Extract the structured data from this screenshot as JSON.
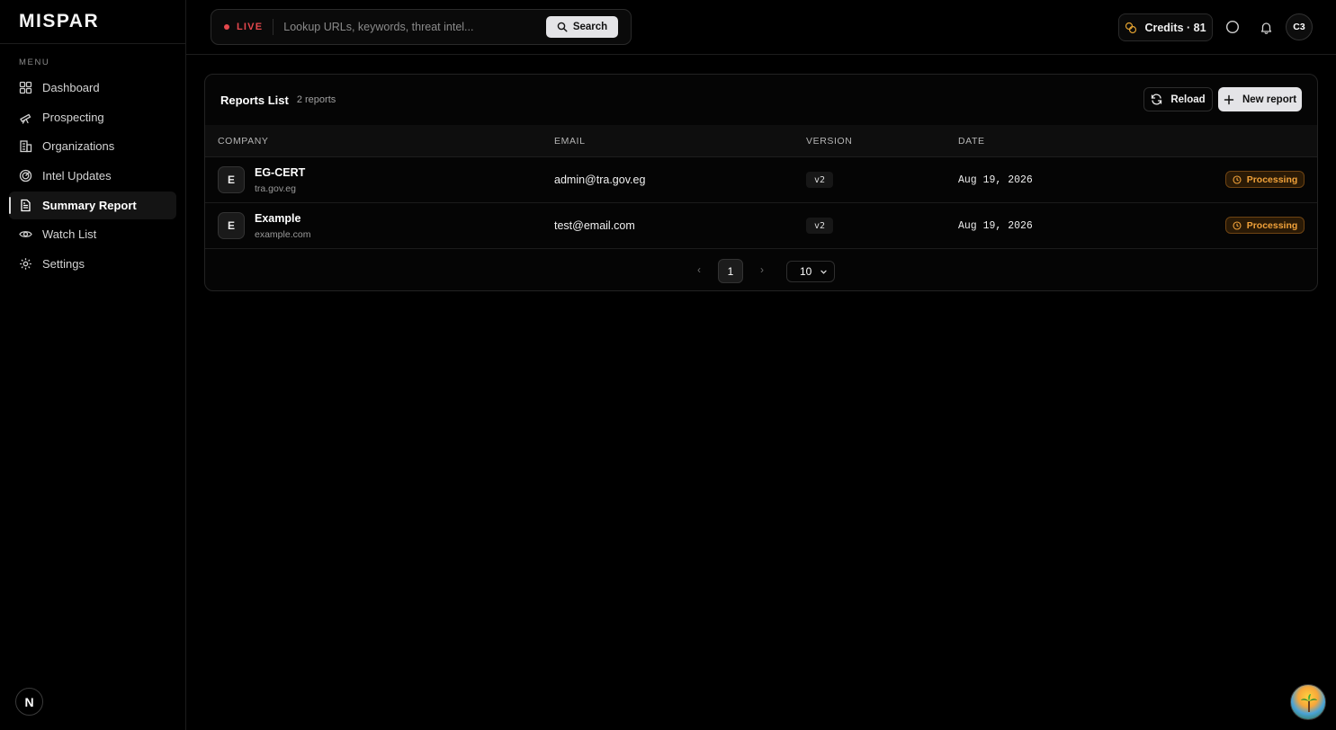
{
  "app": {
    "logo": "MISPAR",
    "menu_label": "MENU",
    "next_badge": "N"
  },
  "sidebar": {
    "items": [
      {
        "label": "Dashboard",
        "icon": "grid-icon",
        "active": false
      },
      {
        "label": "Prospecting",
        "icon": "telescope-icon",
        "active": false
      },
      {
        "label": "Organizations",
        "icon": "building-icon",
        "active": false
      },
      {
        "label": "Intel Updates",
        "icon": "radar-icon",
        "active": false
      },
      {
        "label": "Summary Report",
        "icon": "document-icon",
        "active": true
      },
      {
        "label": "Watch List",
        "icon": "eye-icon",
        "active": false
      },
      {
        "label": "Settings",
        "icon": "gear-icon",
        "active": false
      }
    ]
  },
  "header": {
    "live_label": "LIVE",
    "search_placeholder": "Lookup URLs, keywords, threat intel...",
    "search_button": "Search",
    "credits": "Credits · 81",
    "avatar_initials": "C3"
  },
  "reports": {
    "title": "Reports List",
    "count": "2 reports",
    "reload_label": "Reload",
    "new_label": "New report",
    "columns": [
      "COMPANY",
      "EMAIL",
      "VERSION",
      "DATE"
    ],
    "rows": [
      {
        "initial": "E",
        "company": "EG-CERT",
        "domain": "tra.gov.eg",
        "email": "admin@tra.gov.eg",
        "version": "v2",
        "date": "Aug 19, 2026",
        "status": "Processing"
      },
      {
        "initial": "E",
        "company": "Example",
        "domain": "example.com",
        "email": "test@email.com",
        "version": "v2",
        "date": "Aug 19, 2026",
        "status": "Processing"
      }
    ]
  },
  "pagination": {
    "prev": "‹",
    "current_page": "1",
    "next": "›",
    "page_size": "10"
  },
  "colors": {
    "live": "#e5484d",
    "status": "#f1a23a",
    "accent_button": "#e4e4e7"
  }
}
